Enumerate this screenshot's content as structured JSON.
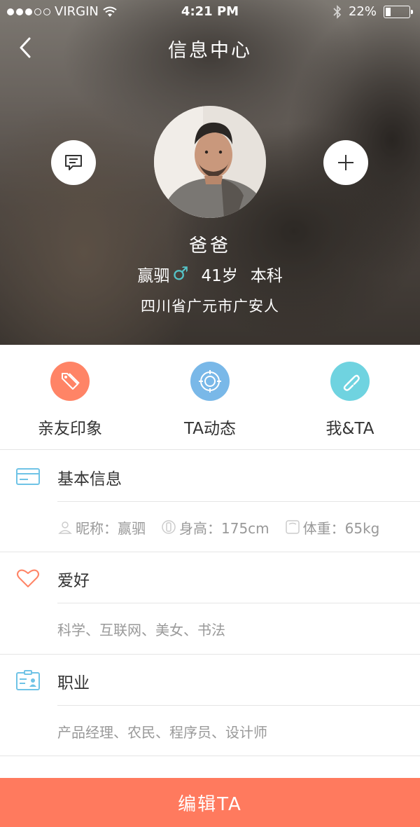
{
  "status_bar": {
    "carrier": "VIRGIN",
    "time": "4:21 PM",
    "battery_text": "22%",
    "battery_level": 0.22,
    "signal_bars_filled": 3,
    "signal_bars_total": 5
  },
  "nav": {
    "title": "信息中心",
    "back_icon": "chevron-left-icon"
  },
  "profile": {
    "name": "爸爸",
    "nickname": "赢驷",
    "gender_symbol": "♂",
    "age": "41岁",
    "education": "本科",
    "origin": "四川省广元市广安人"
  },
  "quick_tabs": [
    {
      "label": "亲友印象",
      "icon": "tag-icon",
      "color": "#ff8466"
    },
    {
      "label": "TA动态",
      "icon": "target-icon",
      "color": "#79b8e8"
    },
    {
      "label": "我&TA",
      "icon": "link-icon",
      "color": "#6fd3e0"
    }
  ],
  "sections": {
    "basic": {
      "title": "基本信息",
      "nickname_label": "昵称：赢驷",
      "height_label": "身高：175cm",
      "weight_label": "体重：65kg"
    },
    "hobby": {
      "title": "爱好",
      "value": "科学、互联网、美女、书法"
    },
    "job": {
      "title": "职业",
      "value": "产品经理、农民、程序员、设计师"
    }
  },
  "edit_button": {
    "label": "编辑TA"
  },
  "colors": {
    "accent": "#ff7a5e",
    "gender": "#55c4c8",
    "card_icon": "#6fc3e6",
    "heart": "#ff8466"
  }
}
